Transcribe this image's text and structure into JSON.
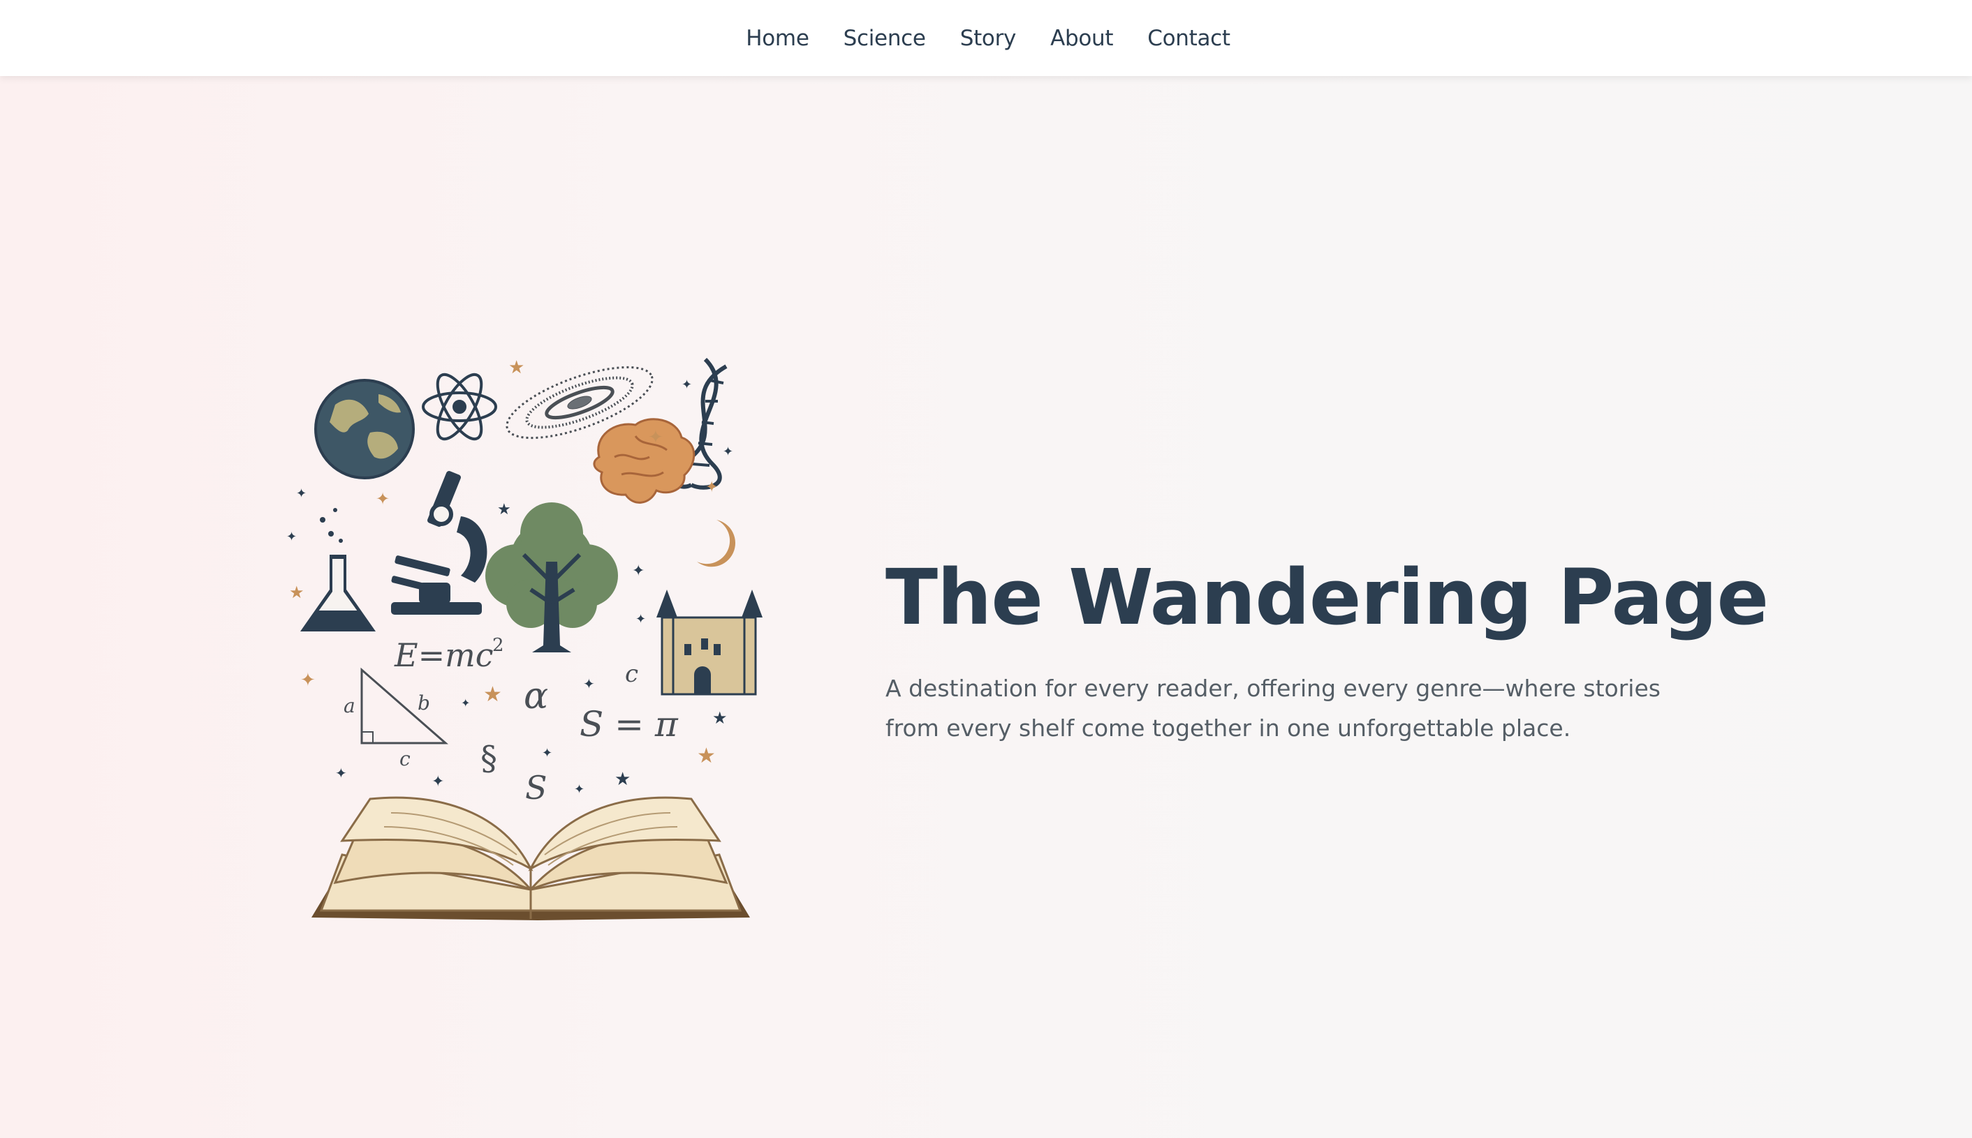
{
  "nav": {
    "items": [
      "Home",
      "Science",
      "Story",
      "About",
      "Contact"
    ]
  },
  "hero": {
    "title": "The Wandering Page",
    "subtitle": "A destination for every reader, offering every genre—where stories from every shelf come together in one unforgettable place.",
    "illustration": {
      "formula": "E=mc",
      "formula_exp": "2",
      "triangle_labels": [
        "a",
        "b",
        "c"
      ],
      "symbols": [
        "α",
        "c",
        "S = π",
        "§",
        "S"
      ]
    }
  },
  "colors": {
    "navy": "#2c3e50",
    "gold": "#c8925a",
    "tree_green": "#6f8a63",
    "brain": "#d9975c",
    "castle": "#d9c59a",
    "page": "#f2e3c4"
  }
}
